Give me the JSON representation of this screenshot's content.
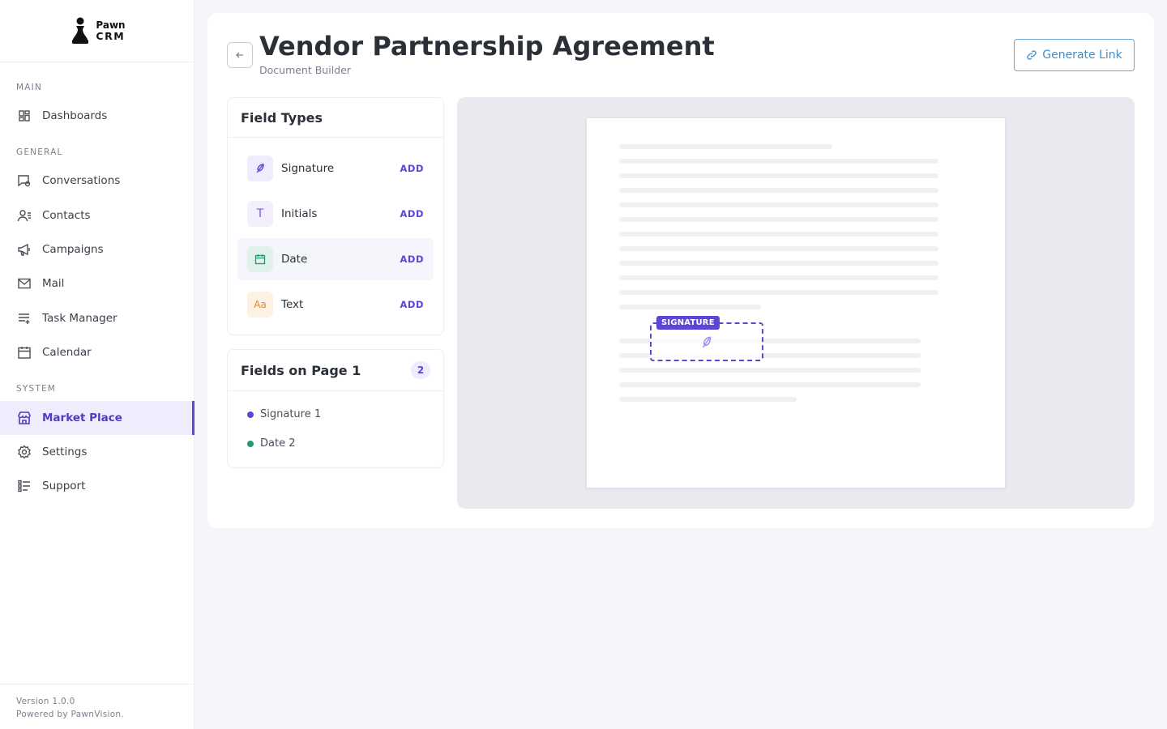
{
  "brand": {
    "line1": "Pawn",
    "line2": "CRM"
  },
  "sidebar": {
    "sections": {
      "main": "MAIN",
      "general": "GENERAL",
      "system": "SYSTEM"
    },
    "items": [
      {
        "label": "Dashboards",
        "icon": "grid-icon"
      },
      {
        "label": "Conversations",
        "icon": "chat-icon"
      },
      {
        "label": "Contacts",
        "icon": "contacts-icon"
      },
      {
        "label": "Campaigns",
        "icon": "megaphone-icon"
      },
      {
        "label": "Mail",
        "icon": "mail-icon"
      },
      {
        "label": "Task Manager",
        "icon": "task-list-icon"
      },
      {
        "label": "Calendar",
        "icon": "calendar-icon"
      },
      {
        "label": "Market Place",
        "icon": "store-icon",
        "active": true
      },
      {
        "label": "Settings",
        "icon": "gear-icon"
      },
      {
        "label": "Support",
        "icon": "support-list-icon"
      }
    ],
    "footer": {
      "version": "Version 1.0.0",
      "powered": "Powered by PawnVision."
    }
  },
  "header": {
    "title": "Vendor Partnership Agreement",
    "subtitle": "Document Builder",
    "generate_label": "Generate Link"
  },
  "field_types": {
    "title": "Field Types",
    "items": [
      {
        "label": "Signature",
        "add": "ADD",
        "icon": "feather-icon"
      },
      {
        "label": "Initials",
        "add": "ADD",
        "icon_text": "T"
      },
      {
        "label": "Date",
        "add": "ADD",
        "icon": "calendar-icon"
      },
      {
        "label": "Text",
        "add": "ADD",
        "icon_text": "Aa"
      }
    ]
  },
  "page_fields": {
    "title": "Fields on Page 1",
    "count": "2",
    "items": [
      {
        "label": "Signature 1",
        "color": "#5b46d6"
      },
      {
        "label": "Date 2",
        "color": "#1f9d6b"
      }
    ]
  },
  "document": {
    "signature_tag": "SIGNATURE"
  },
  "colors": {
    "accent": "#5b46d6",
    "link": "#3f8fcc",
    "date_green": "#1f9d6b",
    "text_orange": "#e08a2c"
  }
}
